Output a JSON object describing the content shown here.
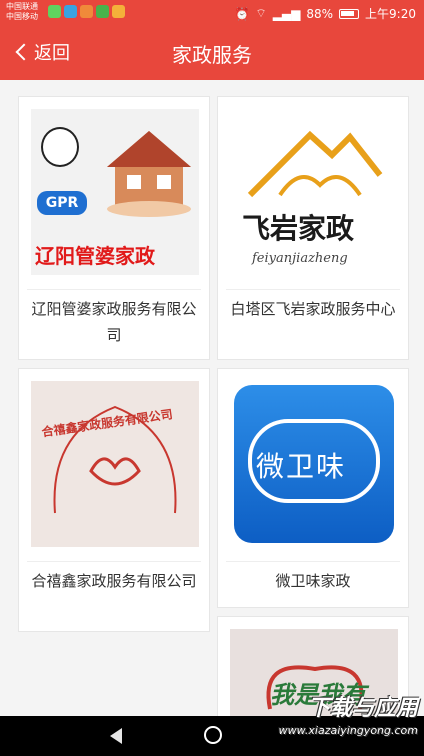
{
  "status_bar": {
    "carrier1": "中国联通",
    "carrier2": "中国移动",
    "battery": "88%",
    "time": "上午9:20"
  },
  "app_bar": {
    "back_label": "返回",
    "title": "家政服务"
  },
  "cards": [
    {
      "name": "辽阳管婆家政服务有限公司",
      "logo_text": "辽阳管婆家政",
      "logo_badge": "GPR"
    },
    {
      "name": "白塔区飞岩家政服务中心",
      "logo_text": "飞岩家政",
      "logo_sub": "feiyanjiazheng"
    },
    {
      "name": "合禧鑫家政服务有限公司",
      "logo_text": "合禧鑫家政服务有限公司"
    },
    {
      "name": "微卫味家政",
      "logo_text": "微卫味"
    },
    {
      "name": "",
      "logo_text": "我是我有"
    }
  ],
  "watermark": {
    "main": "下载与应用",
    "sub": "www.xiazaiyingyong.com"
  },
  "colors": {
    "primary": "#e8473c"
  }
}
